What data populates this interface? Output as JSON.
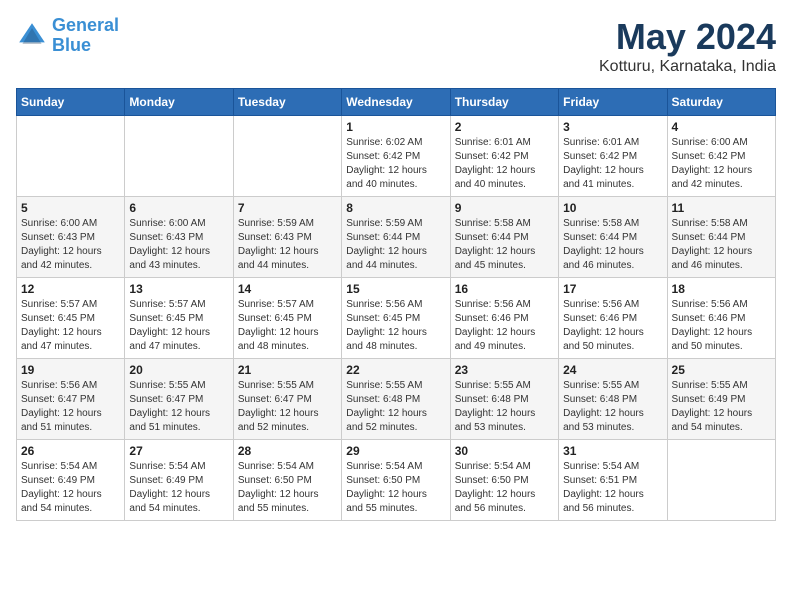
{
  "logo": {
    "line1": "General",
    "line2": "Blue"
  },
  "title": "May 2024",
  "location": "Kotturu, Karnataka, India",
  "weekdays": [
    "Sunday",
    "Monday",
    "Tuesday",
    "Wednesday",
    "Thursday",
    "Friday",
    "Saturday"
  ],
  "weeks": [
    [
      {
        "day": "",
        "info": ""
      },
      {
        "day": "",
        "info": ""
      },
      {
        "day": "",
        "info": ""
      },
      {
        "day": "1",
        "info": "Sunrise: 6:02 AM\nSunset: 6:42 PM\nDaylight: 12 hours\nand 40 minutes."
      },
      {
        "day": "2",
        "info": "Sunrise: 6:01 AM\nSunset: 6:42 PM\nDaylight: 12 hours\nand 40 minutes."
      },
      {
        "day": "3",
        "info": "Sunrise: 6:01 AM\nSunset: 6:42 PM\nDaylight: 12 hours\nand 41 minutes."
      },
      {
        "day": "4",
        "info": "Sunrise: 6:00 AM\nSunset: 6:42 PM\nDaylight: 12 hours\nand 42 minutes."
      }
    ],
    [
      {
        "day": "5",
        "info": "Sunrise: 6:00 AM\nSunset: 6:43 PM\nDaylight: 12 hours\nand 42 minutes."
      },
      {
        "day": "6",
        "info": "Sunrise: 6:00 AM\nSunset: 6:43 PM\nDaylight: 12 hours\nand 43 minutes."
      },
      {
        "day": "7",
        "info": "Sunrise: 5:59 AM\nSunset: 6:43 PM\nDaylight: 12 hours\nand 44 minutes."
      },
      {
        "day": "8",
        "info": "Sunrise: 5:59 AM\nSunset: 6:44 PM\nDaylight: 12 hours\nand 44 minutes."
      },
      {
        "day": "9",
        "info": "Sunrise: 5:58 AM\nSunset: 6:44 PM\nDaylight: 12 hours\nand 45 minutes."
      },
      {
        "day": "10",
        "info": "Sunrise: 5:58 AM\nSunset: 6:44 PM\nDaylight: 12 hours\nand 46 minutes."
      },
      {
        "day": "11",
        "info": "Sunrise: 5:58 AM\nSunset: 6:44 PM\nDaylight: 12 hours\nand 46 minutes."
      }
    ],
    [
      {
        "day": "12",
        "info": "Sunrise: 5:57 AM\nSunset: 6:45 PM\nDaylight: 12 hours\nand 47 minutes."
      },
      {
        "day": "13",
        "info": "Sunrise: 5:57 AM\nSunset: 6:45 PM\nDaylight: 12 hours\nand 47 minutes."
      },
      {
        "day": "14",
        "info": "Sunrise: 5:57 AM\nSunset: 6:45 PM\nDaylight: 12 hours\nand 48 minutes."
      },
      {
        "day": "15",
        "info": "Sunrise: 5:56 AM\nSunset: 6:45 PM\nDaylight: 12 hours\nand 48 minutes."
      },
      {
        "day": "16",
        "info": "Sunrise: 5:56 AM\nSunset: 6:46 PM\nDaylight: 12 hours\nand 49 minutes."
      },
      {
        "day": "17",
        "info": "Sunrise: 5:56 AM\nSunset: 6:46 PM\nDaylight: 12 hours\nand 50 minutes."
      },
      {
        "day": "18",
        "info": "Sunrise: 5:56 AM\nSunset: 6:46 PM\nDaylight: 12 hours\nand 50 minutes."
      }
    ],
    [
      {
        "day": "19",
        "info": "Sunrise: 5:56 AM\nSunset: 6:47 PM\nDaylight: 12 hours\nand 51 minutes."
      },
      {
        "day": "20",
        "info": "Sunrise: 5:55 AM\nSunset: 6:47 PM\nDaylight: 12 hours\nand 51 minutes."
      },
      {
        "day": "21",
        "info": "Sunrise: 5:55 AM\nSunset: 6:47 PM\nDaylight: 12 hours\nand 52 minutes."
      },
      {
        "day": "22",
        "info": "Sunrise: 5:55 AM\nSunset: 6:48 PM\nDaylight: 12 hours\nand 52 minutes."
      },
      {
        "day": "23",
        "info": "Sunrise: 5:55 AM\nSunset: 6:48 PM\nDaylight: 12 hours\nand 53 minutes."
      },
      {
        "day": "24",
        "info": "Sunrise: 5:55 AM\nSunset: 6:48 PM\nDaylight: 12 hours\nand 53 minutes."
      },
      {
        "day": "25",
        "info": "Sunrise: 5:55 AM\nSunset: 6:49 PM\nDaylight: 12 hours\nand 54 minutes."
      }
    ],
    [
      {
        "day": "26",
        "info": "Sunrise: 5:54 AM\nSunset: 6:49 PM\nDaylight: 12 hours\nand 54 minutes."
      },
      {
        "day": "27",
        "info": "Sunrise: 5:54 AM\nSunset: 6:49 PM\nDaylight: 12 hours\nand 54 minutes."
      },
      {
        "day": "28",
        "info": "Sunrise: 5:54 AM\nSunset: 6:50 PM\nDaylight: 12 hours\nand 55 minutes."
      },
      {
        "day": "29",
        "info": "Sunrise: 5:54 AM\nSunset: 6:50 PM\nDaylight: 12 hours\nand 55 minutes."
      },
      {
        "day": "30",
        "info": "Sunrise: 5:54 AM\nSunset: 6:50 PM\nDaylight: 12 hours\nand 56 minutes."
      },
      {
        "day": "31",
        "info": "Sunrise: 5:54 AM\nSunset: 6:51 PM\nDaylight: 12 hours\nand 56 minutes."
      },
      {
        "day": "",
        "info": ""
      }
    ]
  ]
}
